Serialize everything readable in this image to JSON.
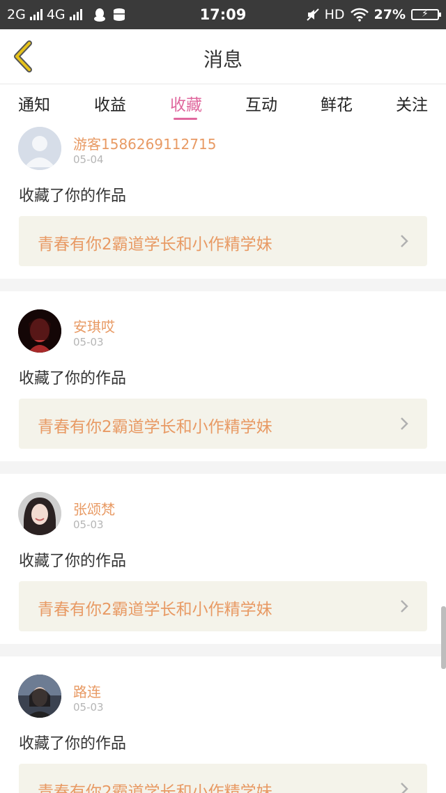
{
  "status_bar": {
    "net1": "2G",
    "net2": "4G",
    "time": "17:09",
    "hd": "HD",
    "battery": "27%"
  },
  "header": {
    "title": "消息"
  },
  "tabs": [
    {
      "label": "通知",
      "active": false
    },
    {
      "label": "收益",
      "active": false
    },
    {
      "label": "收藏",
      "active": true
    },
    {
      "label": "互动",
      "active": false
    },
    {
      "label": "鲜花",
      "active": false
    },
    {
      "label": "关注",
      "active": false
    }
  ],
  "messages": [
    {
      "user": "游客1586269112715",
      "date": "05-04",
      "action": "收藏了你的作品",
      "work": "青春有你2霸道学长和小作精学妹",
      "avatar": "default-avatar-icon"
    },
    {
      "user": "安琪哎",
      "date": "05-03",
      "action": "收藏了你的作品",
      "work": "青春有你2霸道学长和小作精学妹",
      "avatar": "user-photo"
    },
    {
      "user": "张颂梵",
      "date": "05-03",
      "action": "收藏了你的作品",
      "work": "青春有你2霸道学长和小作精学妹",
      "avatar": "user-photo"
    },
    {
      "user": "路连",
      "date": "05-03",
      "action": "收藏了你的作品",
      "work": "青春有你2霸道学长和小作精学妹",
      "avatar": "user-photo"
    }
  ],
  "colors": {
    "accent": "#e0689e",
    "name": "#e89a64",
    "back_arrow": "#e6c21a",
    "link_bg": "#f4f3ea"
  }
}
